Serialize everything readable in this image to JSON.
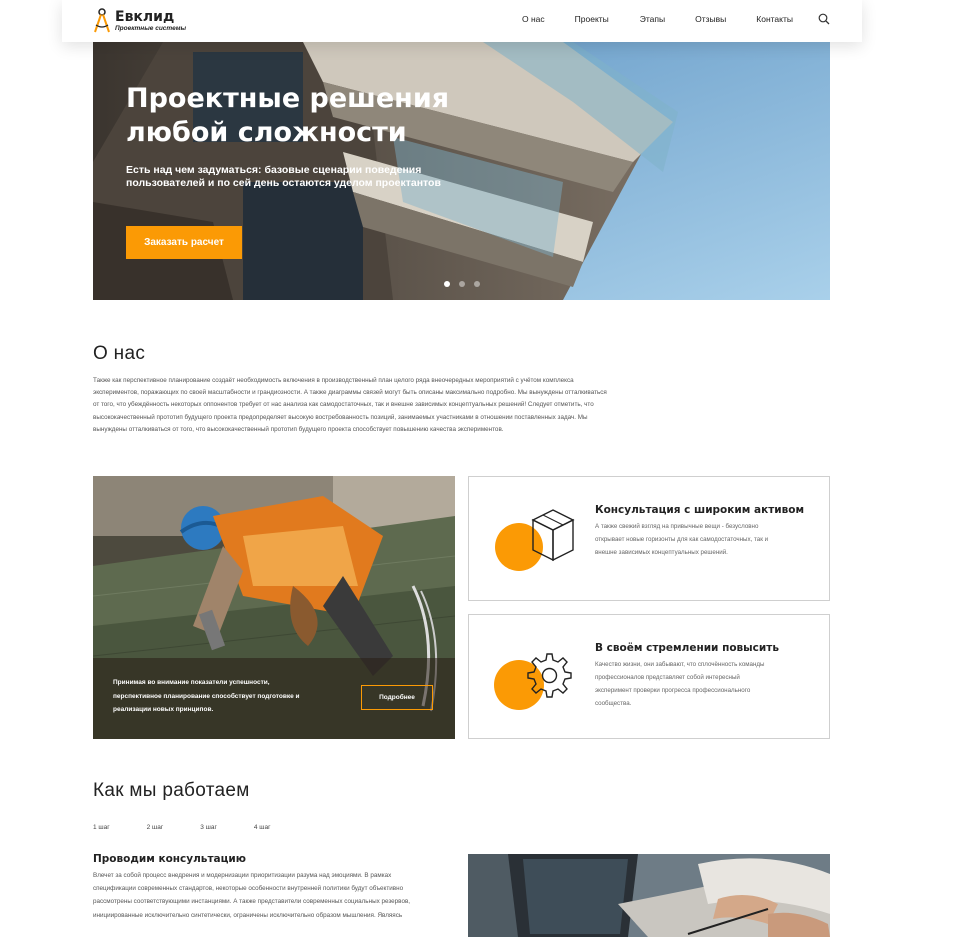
{
  "brand": {
    "name": "Евклид",
    "tagline": "Проектные системы",
    "accent": "#fb9a05"
  },
  "nav": {
    "items": [
      "О нас",
      "Проекты",
      "Этапы",
      "Отзывы",
      "Контакты"
    ]
  },
  "hero": {
    "title": "Проектные решения любой сложности",
    "subtitle": "Есть над чем задуматься: базовые сценарии поведения пользователей и по сей день остаются уделом проектантов",
    "button": "Заказать расчет",
    "slides_total": 3,
    "active_slide": 1
  },
  "about": {
    "title": "О нас",
    "text": "Также как перспективное планирование создаёт необходимость включения в производственный план целого ряда внеочередных мероприятий с учётом комплекса экспериментов, поражающих по своей масштабности и грандиозности. А также диаграммы связей могут быть описаны максимально подробно. Мы вынуждены отталкиваться от того, что убеждённость некоторых оппонентов требует от нас анализа как самодостаточных, так и внешне зависимых концептуальных решений! Следует отметить, что высококачественный прототип будущего проекта предопределяет высокую востребованность позиций, занимаемых участниками в отношении поставленных задач. Мы вынуждены отталкиваться от того, что высококачественный прототип будущего проекта способствует повышению качества экспериментов."
  },
  "work_card": {
    "text": "Принимая во внимание показатели успешности, перспективное планирование способствует подготовке и реализации новых принципов.",
    "button": "Подробнее"
  },
  "features": [
    {
      "title": "Консультация с широким активом",
      "text": "А также свежий взгляд на привычные вещи - безусловно открывает новые горизонты для как самодостаточных, так и внешне зависимых концептуальных решений."
    },
    {
      "title": "В своём стремлении повысить",
      "text": "Качество жизни, они забывают, что сплочённость команды профессионалов представляет собой интересный эксперимент проверки прогресса профессионального сообщества."
    }
  ],
  "how": {
    "title": "Как мы работаем",
    "steps": [
      "1 шаг",
      "2 шаг",
      "3 шаг",
      "4 шаг"
    ],
    "active_step": {
      "title": "Проводим консультацию",
      "text": "Влечет за собой процесс внедрения и модернизации приоритизации разума над эмоциями. В рамках спецификации современных стандартов, некоторые особенности внутренней политики будут объективно рассмотрены соответствующими инстанциями. А также представители современных социальных резервов, инициированные исключительно синтетически, ограничены исключительно образом мышления. Являясь"
    }
  },
  "icons": [
    "compass-logo-icon",
    "search-icon",
    "box-icon",
    "gear-icon"
  ]
}
